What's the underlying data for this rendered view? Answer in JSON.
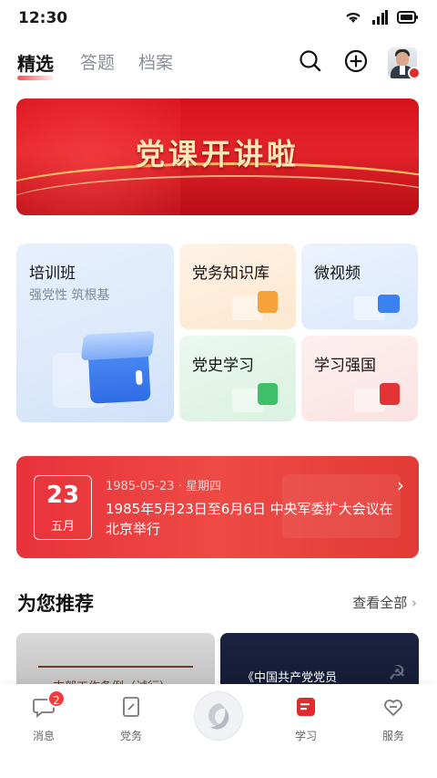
{
  "status_bar": {
    "time": "12:30"
  },
  "top_nav": {
    "tabs": [
      {
        "label": "精选",
        "active": true
      },
      {
        "label": "答题",
        "active": false
      },
      {
        "label": "档案",
        "active": false
      }
    ],
    "icons": [
      "search-icon",
      "add-circle-icon",
      "avatar"
    ]
  },
  "banner": {
    "title": "党课开讲啦"
  },
  "features": {
    "training": {
      "title": "培训班",
      "subtitle": "强党性 筑根基"
    },
    "knowledge": {
      "title": "党务知识库"
    },
    "video": {
      "title": "微视频"
    },
    "history": {
      "title": "党史学习"
    },
    "xuexi": {
      "title": "学习强国"
    }
  },
  "today_in_history": {
    "day": "23",
    "month": "五月",
    "meta": "1985-05-23 · 星期四",
    "text": "1985年5月23日至6月6日 中央军委扩大会议在北京举行"
  },
  "recommend": {
    "title": "为您推荐",
    "see_all": "查看全部",
    "items": [
      {
        "caption": "支部工作条例（试行）"
      },
      {
        "caption": "《中国共产党党员"
      }
    ]
  },
  "tab_bar": {
    "items": [
      {
        "label": "消息",
        "badge": "2",
        "icon": "chat-bubble-icon"
      },
      {
        "label": "党务",
        "icon": "document-edit-icon"
      },
      {
        "label": "",
        "icon": "center-logo-icon"
      },
      {
        "label": "学习",
        "icon": "study-icon",
        "active": true
      },
      {
        "label": "服务",
        "icon": "heart-service-icon"
      }
    ]
  },
  "colors": {
    "accent": "#e12a2a",
    "banner_red": "#d8121b",
    "gold": "#ffe9b8"
  }
}
